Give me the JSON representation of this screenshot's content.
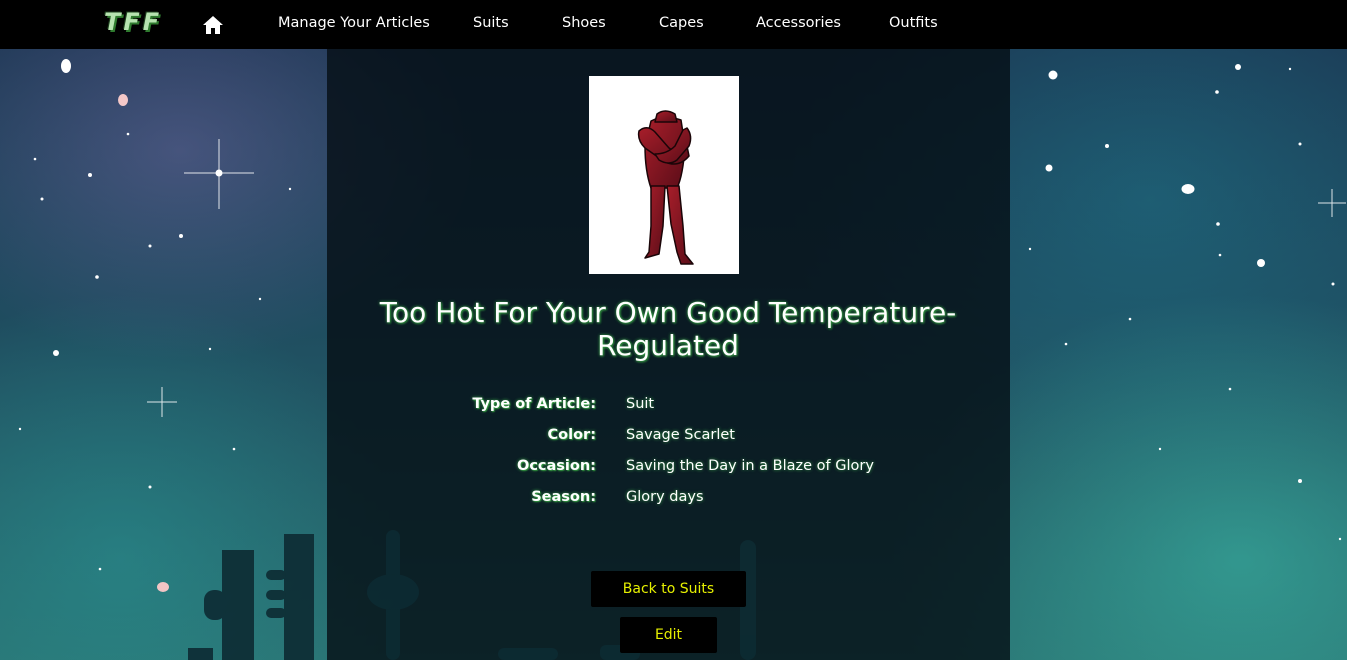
{
  "nav": {
    "logo": "TFF",
    "home_icon": "home-icon",
    "items": [
      {
        "label": "Manage Your Articles"
      },
      {
        "label": "Suits"
      },
      {
        "label": "Shoes"
      },
      {
        "label": "Capes"
      },
      {
        "label": "Accessories"
      },
      {
        "label": "Outfits"
      }
    ]
  },
  "article": {
    "image_icon": "red-suit-figure",
    "title": "Too Hot For Your Own Good Temperature-Regulated",
    "details": [
      {
        "label": "Type of Article:",
        "value": "Suit"
      },
      {
        "label": "Color:",
        "value": "Savage Scarlet"
      },
      {
        "label": "Occasion:",
        "value": "Saving the Day in a Blaze of Glory"
      },
      {
        "label": "Season:",
        "value": "Glory days"
      }
    ]
  },
  "actions": {
    "back_label": "Back to Suits",
    "edit_label": "Edit"
  },
  "colors": {
    "nav_background": "#000000",
    "button_text": "#e6f000",
    "title_glow": "#3aa84a"
  }
}
